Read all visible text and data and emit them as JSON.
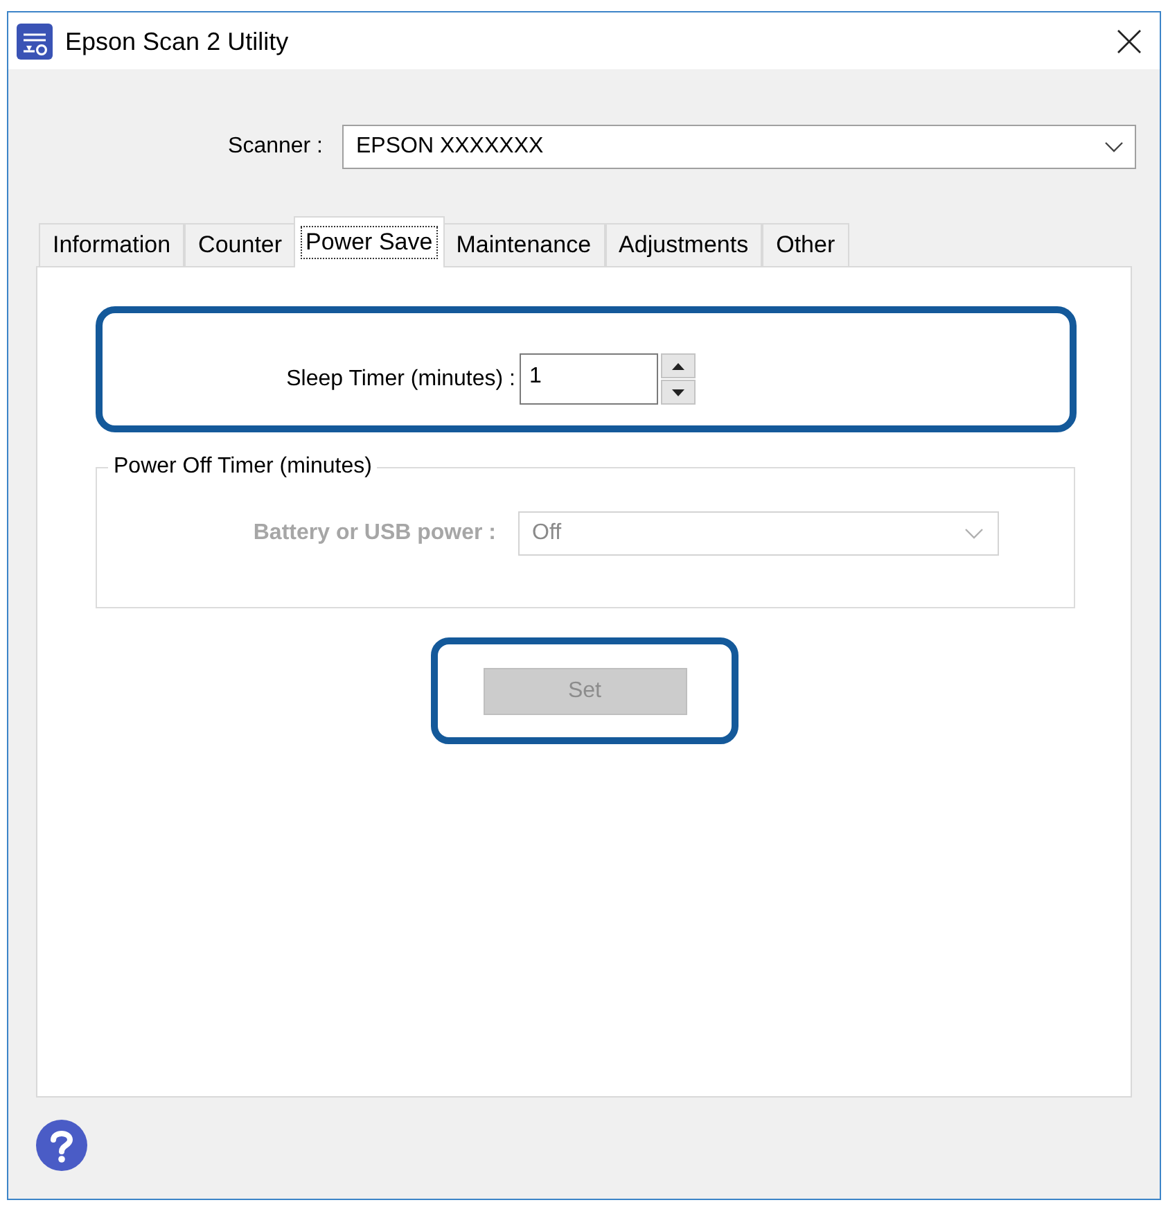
{
  "window": {
    "title": "Epson Scan 2 Utility"
  },
  "scanner": {
    "label": "Scanner :",
    "value": "EPSON XXXXXXX"
  },
  "tabs": [
    {
      "label": "Information",
      "selected": false
    },
    {
      "label": "Counter",
      "selected": false
    },
    {
      "label": "Power Save",
      "selected": true
    },
    {
      "label": "Maintenance",
      "selected": false
    },
    {
      "label": "Adjustments",
      "selected": false
    },
    {
      "label": "Other",
      "selected": false
    }
  ],
  "sleep_timer": {
    "label": "Sleep Timer (minutes) :",
    "value": "1",
    "highlighted": true
  },
  "power_off_timer": {
    "title": "Power Off Timer (minutes)",
    "label": "Battery or USB power :",
    "value": "Off",
    "disabled": true
  },
  "set_button": {
    "label": "Set",
    "disabled": true,
    "highlighted": true
  }
}
